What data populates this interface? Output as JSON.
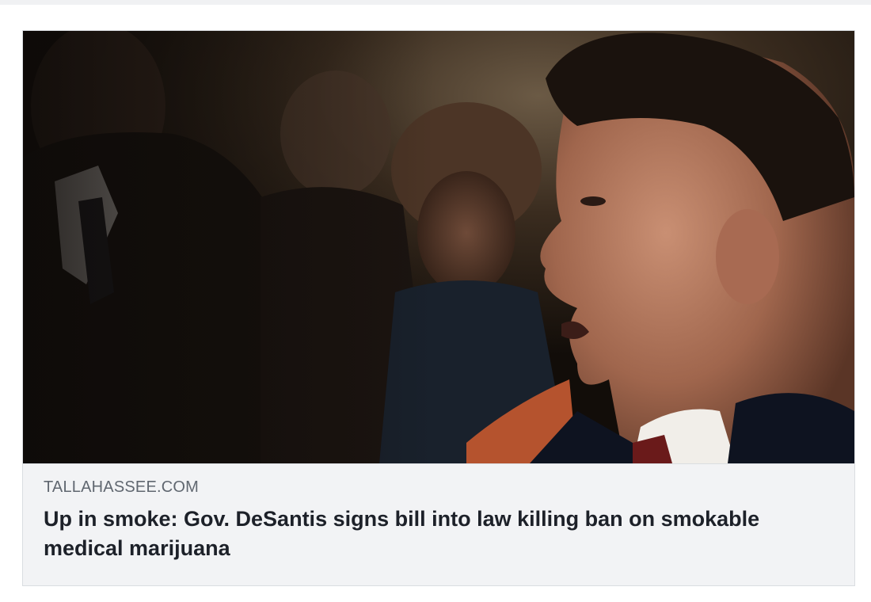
{
  "link_card": {
    "domain": "TALLAHASSEE.COM",
    "headline": "Up in smoke: Gov. DeSantis signs bill into law killing ban on smokable medical marijuana",
    "image": {
      "subject": "photo-of-governor-speaking-with-crowd-behind"
    }
  },
  "colors": {
    "card_background": "#f2f3f5",
    "card_border": "#dadde1",
    "domain_text": "#606770",
    "headline_text": "#1d2129"
  }
}
